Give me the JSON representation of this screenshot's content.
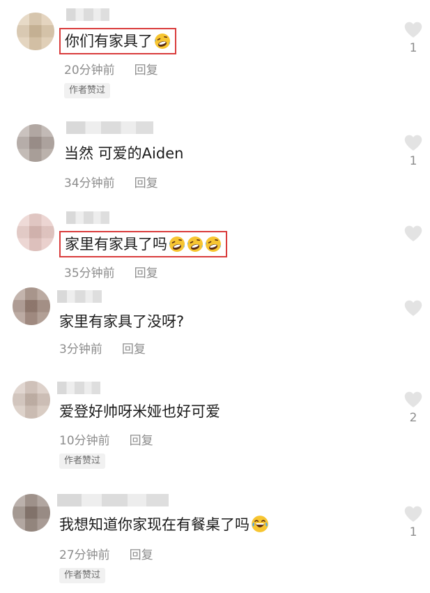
{
  "comments": [
    {
      "text": "你们有家具了",
      "time": "20分钟前",
      "reply": "回复",
      "badge": "作者赞过",
      "likes": "1",
      "emoji_count": 1
    },
    {
      "text": "当然 可爱的Aiden",
      "time": "34分钟前",
      "reply": "回复",
      "badge": "",
      "likes": "1",
      "emoji_count": 0
    },
    {
      "text": "家里有家具了吗",
      "time": "35分钟前",
      "reply": "回复",
      "badge": "",
      "likes": "",
      "emoji_count": 3
    },
    {
      "text": "家里有家具了没呀?",
      "time": "3分钟前",
      "reply": "回复",
      "badge": "",
      "likes": "",
      "emoji_count": 0
    },
    {
      "text": "爱登好帅呀米娅也好可爱",
      "time": "10分钟前",
      "reply": "回复",
      "badge": "作者赞过",
      "likes": "2",
      "emoji_count": 0
    },
    {
      "text": "我想知道你家现在有餐桌了吗",
      "time": "27分钟前",
      "reply": "回复",
      "badge": "作者赞过",
      "likes": "1",
      "emoji_count": 1
    }
  ],
  "icons": {
    "like": "heart-icon",
    "laugh_emoji": "rolling-on-floor-laughing-emoji",
    "cry_laugh_emoji": "tears-of-joy-emoji"
  },
  "colors": {
    "highlight_box": "#d93b3b",
    "meta_text": "#8c8c8c",
    "heart": "#e1e1e1"
  }
}
